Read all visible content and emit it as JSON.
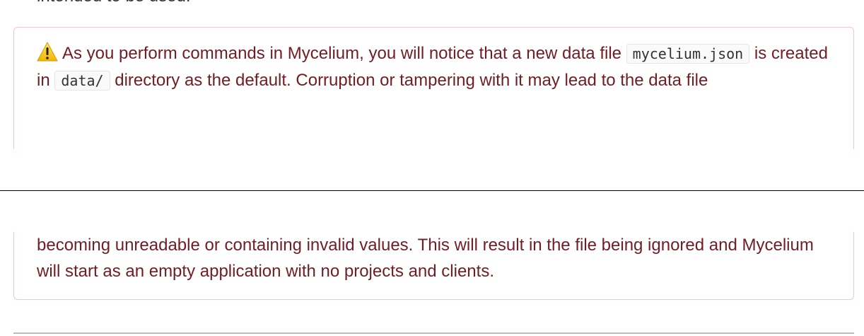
{
  "previous_text": "intended to be used.",
  "alert": {
    "icon": "warning-icon",
    "part1_a": "As you perform commands in Mycelium, you will notice that a new data file ",
    "code1": "mycelium.json",
    "part1_b": " is created in ",
    "code2": "data/",
    "part1_c": " directory as the default. Corruption or tampering with it may lead to the data file",
    "part2": "becoming unreadable or containing invalid values. This will result in the file being ignored and Mycelium will start as an empty application with no projects and clients."
  }
}
